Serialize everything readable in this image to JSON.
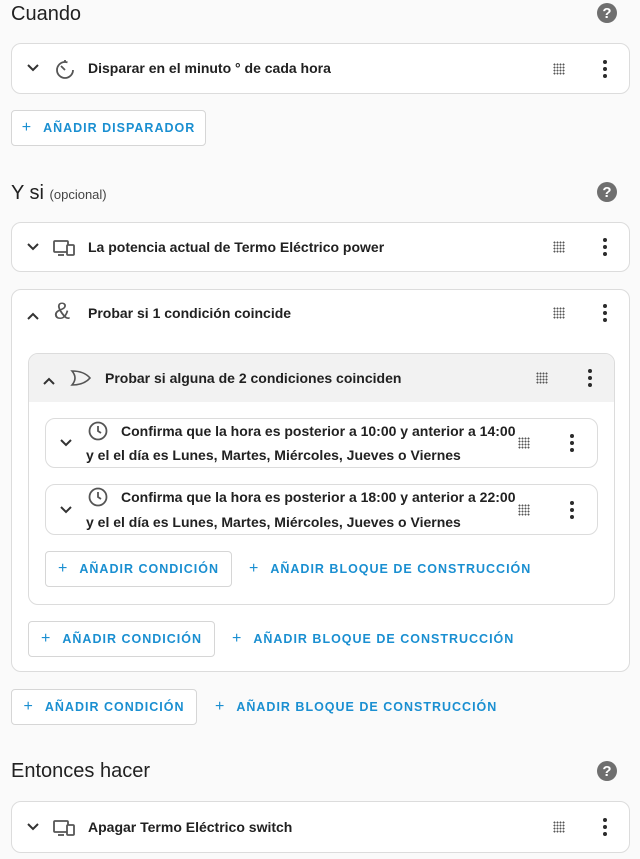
{
  "sections": {
    "when": {
      "title": "Cuando"
    },
    "if": {
      "title": "Y si",
      "optional": "(opcional)"
    },
    "then": {
      "title": "Entonces hacer"
    }
  },
  "help_icon": {
    "glyph": "?",
    "icon": "help-circle-icon"
  },
  "trigger": {
    "label": "Disparar en el minuto ° de cada hora",
    "icon": "timer-outline-icon"
  },
  "add_trigger": {
    "label": "AÑADIR DISPARADOR"
  },
  "conditions": {
    "device_condition": {
      "label": "La potencia actual de Termo Eléctrico power",
      "icon": "devices-icon"
    },
    "and_block": {
      "label": "Probar si 1 condición coincide",
      "icon_glyph": "&",
      "or_block": {
        "label": "Probar si alguna de 2 condiciones coinciden",
        "icon": "gate-or-icon",
        "items": [
          {
            "line1": "Confirma que la hora es posterior a 10:00 y anterior a 14:00",
            "line2": "y el el día es Lunes, Martes, Miércoles, Jueves o Viernes",
            "icon": "clock-icon"
          },
          {
            "line1": "Confirma que la hora es posterior a 18:00 y anterior a 22:00",
            "line2": "y el el día es Lunes, Martes, Miércoles, Jueves o Viernes",
            "icon": "clock-icon"
          }
        ],
        "add_condition": "AÑADIR CONDICIÓN",
        "add_building_block": "AÑADIR BLOQUE DE CONSTRUCCIÓN"
      },
      "add_condition": "AÑADIR CONDICIÓN",
      "add_building_block": "AÑADIR BLOQUE DE CONSTRUCCIÓN"
    },
    "add_condition": "AÑADIR CONDICIÓN",
    "add_building_block": "AÑADIR BLOQUE DE CONSTRUCCIÓN"
  },
  "action": {
    "label": "Apagar Termo Eléctrico switch",
    "icon": "devices-icon"
  },
  "glyphs": {
    "expand": "⌄",
    "collapse": "⌃",
    "plus": "+"
  },
  "colors": {
    "accent": "#1a8fd1",
    "help": "#6f6f6f",
    "block_header": "#f2f2f2"
  }
}
